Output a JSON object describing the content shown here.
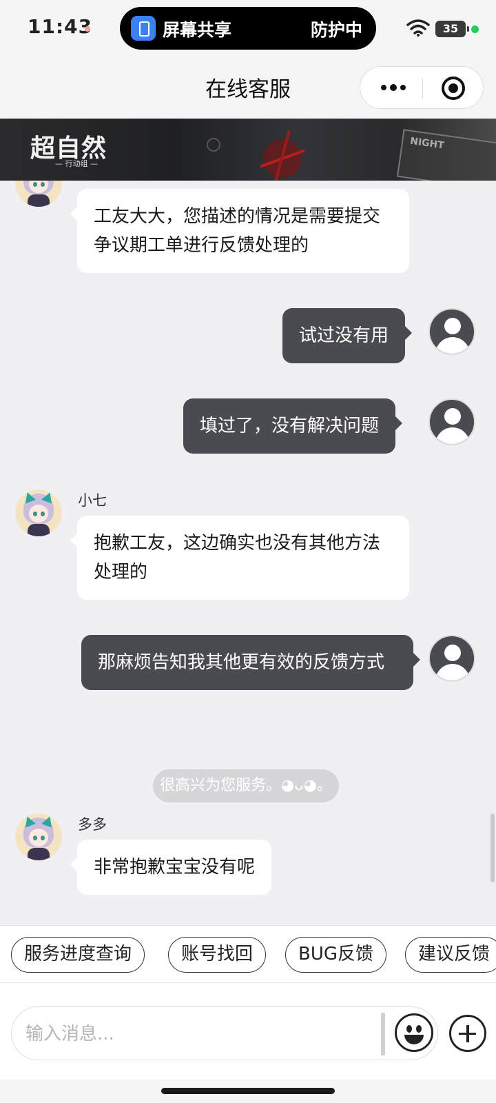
{
  "status_bar": {
    "time": "11:43",
    "screen_share_label": "屏幕共享",
    "protection_label": "防护中",
    "battery": "35"
  },
  "nav": {
    "title": "在线客服"
  },
  "banner": {
    "logo_text": "超自然",
    "logo_sub": "— 行动组 —",
    "night_tag": "NIGHT"
  },
  "messages": [
    {
      "from": "agent",
      "text": "工友大大，您描述的情况是需要提交争议期工单进行反馈处理的"
    },
    {
      "from": "user",
      "text": "试过没有用"
    },
    {
      "from": "user",
      "text": "填过了，没有解决问题"
    },
    {
      "from": "agent",
      "sender": "小七",
      "text": "抱歉工友，这边确实也没有其他方法处理的"
    },
    {
      "from": "user",
      "text": "那麻烦告知我其他更有效的反馈方式"
    },
    {
      "from": "system",
      "text": "很高兴为您服务。◕ᴗ◕。"
    },
    {
      "from": "agent",
      "sender": "多多",
      "text": "非常抱歉宝宝没有呢"
    }
  ],
  "quick_replies": [
    "服务进度查询",
    "账号找回",
    "BUG反馈",
    "建议反馈"
  ],
  "input": {
    "placeholder": "输入消息..."
  },
  "colors": {
    "user_bubble": "#4a4b50",
    "agent_bubble": "#ffffff",
    "chat_background": "#efeff4",
    "status_green": "#1fd15a",
    "share_blue": "#3d7ff4"
  }
}
